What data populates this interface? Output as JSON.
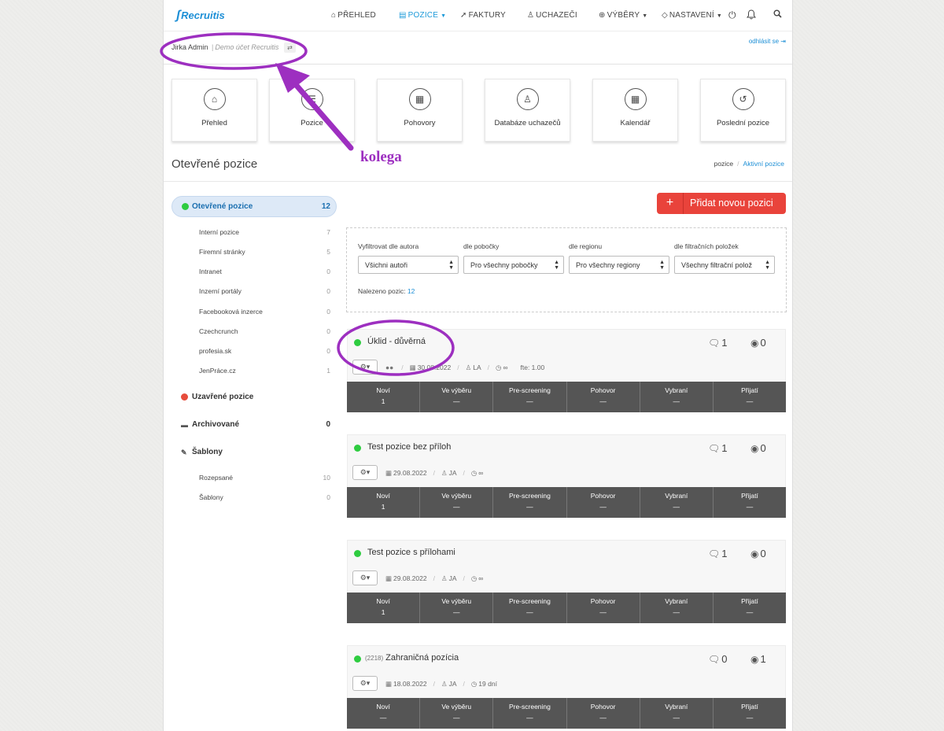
{
  "nav": {
    "logo": "Recruitis",
    "items": [
      {
        "label": "PŘEHLED",
        "icon": "home-icon"
      },
      {
        "label": "POZICE",
        "icon": "folder-icon",
        "active": true,
        "dropdown": true
      },
      {
        "label": "FAKTURY",
        "icon": "paper-plane-icon"
      },
      {
        "label": "UCHAZEČI",
        "icon": "user-icon"
      },
      {
        "label": "VÝBĚRY",
        "icon": "globe-icon",
        "dropdown": true
      },
      {
        "label": "NASTAVENÍ",
        "icon": "tag-icon",
        "dropdown": true
      }
    ]
  },
  "user": {
    "name": "Jirka Admin",
    "separator": "|",
    "account": "Demo účet Recruitis",
    "logout": "odhlásit se"
  },
  "tiles": [
    {
      "label": "Přehled",
      "icon": "home-icon"
    },
    {
      "label": "Pozice",
      "icon": "list-icon"
    },
    {
      "label": "Pohovory",
      "icon": "calendar-clock-icon"
    },
    {
      "label": "Databáze uchazečů",
      "icon": "user-circle-icon"
    },
    {
      "label": "Kalendář",
      "icon": "calendar-icon"
    },
    {
      "label": "Poslední pozice",
      "icon": "history-icon"
    }
  ],
  "page": {
    "title": "Otevřené pozice",
    "breadcrumb": [
      "pozice",
      "/",
      "Aktivní pozice"
    ]
  },
  "sidebar": {
    "open": {
      "label": "Otevřené pozice",
      "count": "12"
    },
    "open_items": [
      {
        "label": "Interní pozice",
        "count": "7"
      },
      {
        "label": "Firemní stránky",
        "count": "5"
      },
      {
        "label": "Intranet",
        "count": "0"
      },
      {
        "label": "Inzerní portály",
        "count": "0"
      },
      {
        "label": "Facebooková inzerce",
        "count": "0"
      },
      {
        "label": "Czechcrunch",
        "count": "0"
      },
      {
        "label": "profesia.sk",
        "count": "0"
      },
      {
        "label": "JenPráce.cz",
        "count": "1"
      }
    ],
    "closed": {
      "label": "Uzavřené pozice",
      "count": ""
    },
    "archived": {
      "label": "Archivované",
      "count": "0"
    },
    "templates": {
      "label": "Šablony",
      "count": ""
    },
    "template_items": [
      {
        "label": "Rozepsané",
        "count": "10"
      },
      {
        "label": "Šablony",
        "count": "0"
      }
    ]
  },
  "add_button": {
    "plus": "+",
    "label": "Přidat novou pozici"
  },
  "filters": {
    "author": {
      "label": "Vyfiltrovat dle autora",
      "value": "Všichni autoři"
    },
    "branch": {
      "label": "dle pobočky",
      "value": "Pro všechny pobočky"
    },
    "region": {
      "label": "dle regionu",
      "value": "Pro všechny regiony"
    },
    "items": {
      "label": "dle filtračních položek",
      "value": "Všechny filtrační polož"
    },
    "found_label": "Nalezeno pozic:",
    "found_count": "12"
  },
  "pipeline_labels": [
    "Noví",
    "Ve výběru",
    "Pre-screening",
    "Pohovor",
    "Vybraní",
    "Přijatí"
  ],
  "positions": [
    {
      "prefix": "",
      "title": "Úklid - důvěrná",
      "comments": "1",
      "views": "0",
      "date": "30.08.2022",
      "author": "LA",
      "duration": "∞",
      "fte": "fte: 1.00",
      "pipeline": [
        "1",
        "—",
        "—",
        "—",
        "—",
        "—"
      ]
    },
    {
      "prefix": "",
      "title": "Test pozice bez příloh",
      "comments": "1",
      "views": "0",
      "date": "29.08.2022",
      "author": "JA",
      "duration": "∞",
      "fte": "",
      "pipeline": [
        "1",
        "—",
        "—",
        "—",
        "—",
        "—"
      ]
    },
    {
      "prefix": "",
      "title": "Test pozice s přílohami",
      "comments": "1",
      "views": "0",
      "date": "29.08.2022",
      "author": "JA",
      "duration": "∞",
      "fte": "",
      "pipeline": [
        "1",
        "—",
        "—",
        "—",
        "—",
        "—"
      ]
    },
    {
      "prefix": "(2218)",
      "title": "Zahraničná pozícia",
      "comments": "0",
      "views": "1",
      "date": "18.08.2022",
      "author": "JA",
      "duration": "19 dní",
      "fte": "",
      "pipeline": [
        "—",
        "—",
        "—",
        "—",
        "—",
        "—"
      ]
    }
  ],
  "annotation": {
    "text": "kolega",
    "color": "#9d2fc0"
  },
  "colors": {
    "accent": "#1d8fd6",
    "add_button": "#e9433b",
    "pipeline_bg": "#555555",
    "status_open": "#2ecc40",
    "status_closed": "#e74c3c"
  }
}
